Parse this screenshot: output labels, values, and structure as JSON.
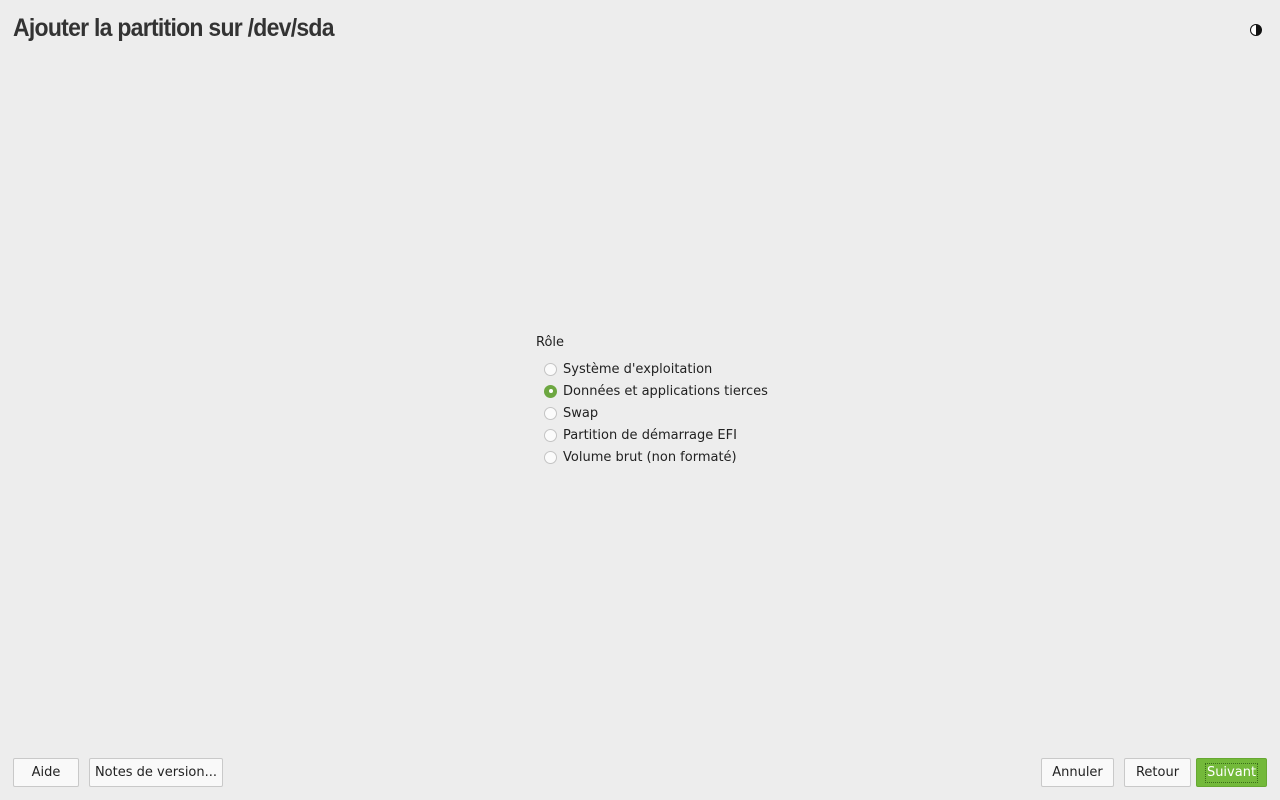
{
  "page": {
    "title": "Ajouter la partition sur /dev/sda"
  },
  "theme_toggle": {
    "icon": "half-moon-icon"
  },
  "role": {
    "label": "Rôle",
    "options": [
      {
        "label": "Système d'exploitation",
        "selected": false
      },
      {
        "label": "Données et applications tierces",
        "selected": true
      },
      {
        "label": "Swap",
        "selected": false
      },
      {
        "label": "Partition de démarrage EFI",
        "selected": false
      },
      {
        "label": "Volume brut (non formaté)",
        "selected": false
      }
    ]
  },
  "buttons": {
    "help": "Aide",
    "release_notes": "Notes de version...",
    "cancel": "Annuler",
    "back": "Retour",
    "next": "Suivant"
  },
  "colors": {
    "background": "#ededed",
    "accent": "#73b93a",
    "radio_selected": "#6da741"
  }
}
